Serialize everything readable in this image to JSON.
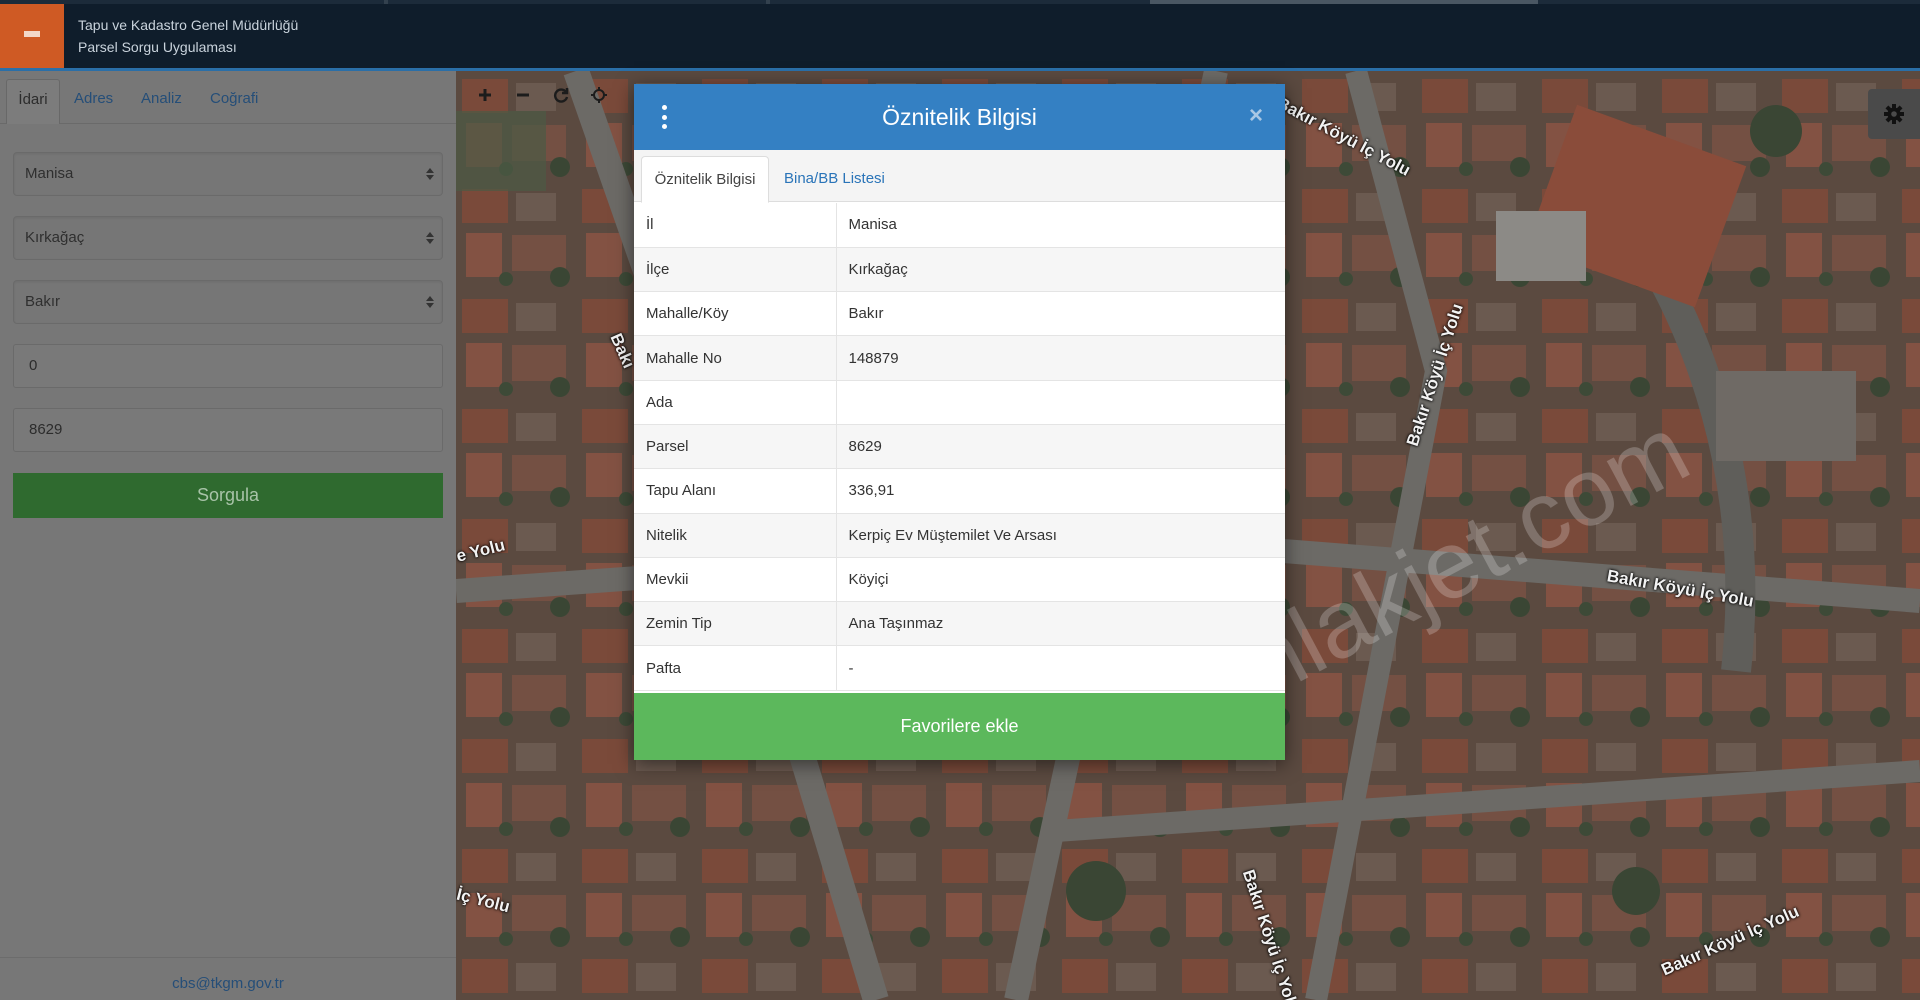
{
  "header": {
    "menu_icon": "hamburger-icon",
    "org_name": "Tapu ve Kadastro Genel Müdürlüğü",
    "app_name": "Parsel Sorgu Uygulaması"
  },
  "sidebar": {
    "tabs": [
      {
        "label": "İdari",
        "active": true
      },
      {
        "label": "Adres",
        "active": false
      },
      {
        "label": "Analiz",
        "active": false
      },
      {
        "label": "Coğrafi",
        "active": false
      }
    ],
    "selects": {
      "province": "Manisa",
      "district": "Kırkağaç",
      "neighborhood": "Bakır"
    },
    "inputs": {
      "block": "0",
      "parcel": "8629"
    },
    "query_button": "Sorgula",
    "footer_email": "cbs@tkgm.gov.tr"
  },
  "map": {
    "toolbar_icons": [
      "zoom-in-icon",
      "zoom-out-icon",
      "refresh-icon",
      "locate-icon"
    ],
    "settings_icon": "gear-icon",
    "watermark": "emlakjet.com",
    "road_labels": [
      "Bakır Köyü İç Yolu",
      "Bakır Köyü İç Yolu",
      "Bakır Köyü İç Yolu",
      "Bakır Köyü İç Yolu",
      "Bakır Köyü İç Yolu",
      "e Yolu",
      "İç Yolu",
      "Bakı"
    ]
  },
  "modal": {
    "title": "Öznitelik Bilgisi",
    "menu_icon": "kebab-icon",
    "close_icon": "close-icon",
    "close_glyph": "×",
    "tabs": [
      {
        "label": "Öznitelik Bilgisi",
        "active": true
      },
      {
        "label": "Bina/BB Listesi",
        "active": false
      }
    ],
    "rows": [
      {
        "key": "İl",
        "value": "Manisa"
      },
      {
        "key": "İlçe",
        "value": "Kırkağaç"
      },
      {
        "key": "Mahalle/Köy",
        "value": "Bakır"
      },
      {
        "key": "Mahalle No",
        "value": "148879"
      },
      {
        "key": "Ada",
        "value": ""
      },
      {
        "key": "Parsel",
        "value": "8629"
      },
      {
        "key": "Tapu Alanı",
        "value": "336,91"
      },
      {
        "key": "Nitelik",
        "value": "Kerpiç Ev Müştemilet Ve Arsası"
      },
      {
        "key": "Mevkii",
        "value": "Köyiçi"
      },
      {
        "key": "Zemin Tip",
        "value": "Ana Taşınmaz"
      },
      {
        "key": "Pafta",
        "value": "-"
      }
    ],
    "favorite_button": "Favorilere ekle"
  },
  "colors": {
    "header_bg": "#0f1d2b",
    "menu_btn": "#cf5a24",
    "modal_header": "#3480c3",
    "favorite_btn": "#5cb85c",
    "query_btn": "#2f6a2f",
    "link": "#2a74b8"
  }
}
